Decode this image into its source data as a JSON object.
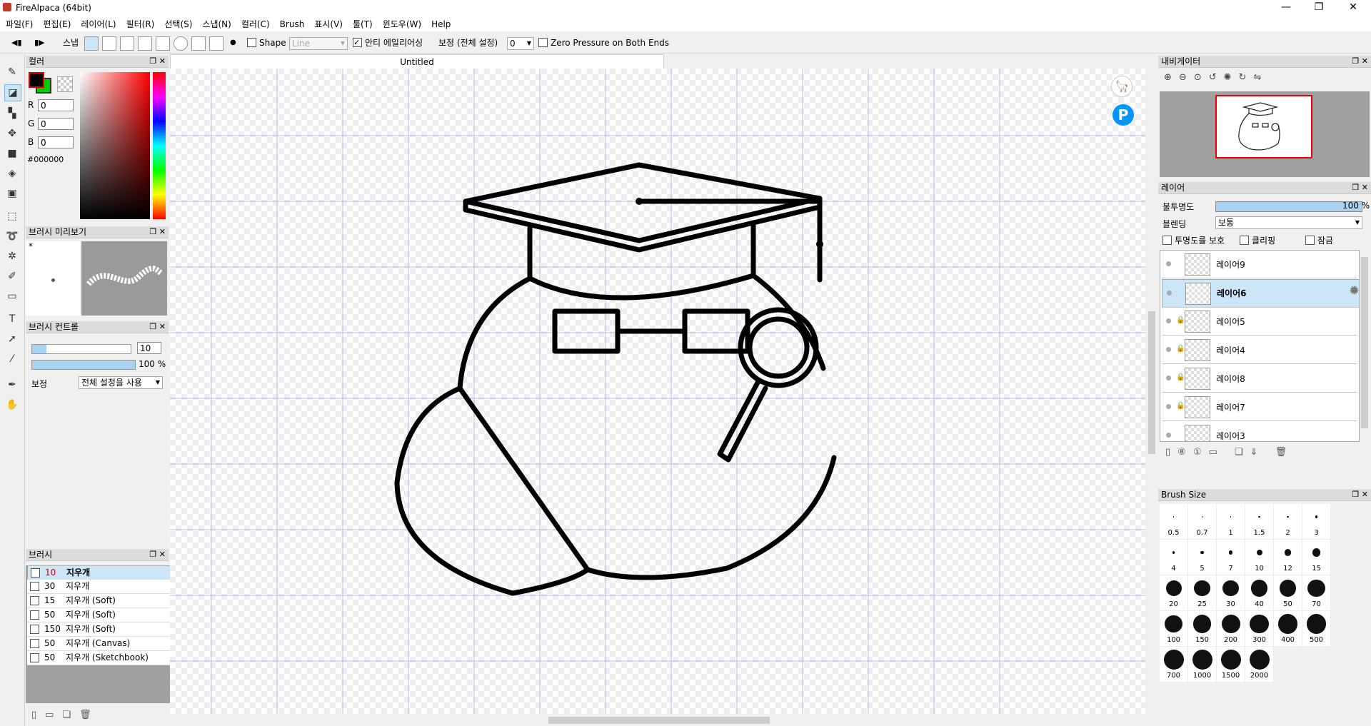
{
  "window": {
    "title": "FireAlpaca (64bit)",
    "minimize": "—",
    "maximize": "❐",
    "close": "✕"
  },
  "menu": [
    "파일(F)",
    "편집(E)",
    "레이어(L)",
    "필터(R)",
    "선택(S)",
    "스냅(N)",
    "컬러(C)",
    "Brush",
    "표시(V)",
    "툴(T)",
    "윈도우(W)",
    "Help"
  ],
  "toolbar": {
    "snap_label": "스냅",
    "shape_label": "Shape",
    "shape_value": "Line",
    "antialias_label": "안티 에일리어싱",
    "correction_label": "보정 (전체 설정)",
    "correction_value": "0",
    "zero_pressure_label": "Zero Pressure on Both Ends"
  },
  "color_panel": {
    "title": "컬러",
    "r_label": "R",
    "g_label": "G",
    "b_label": "B",
    "r": "0",
    "g": "0",
    "b": "0",
    "hex": "#000000",
    "primary_color": "#000000",
    "secondary_color": "#00cc00"
  },
  "brush_preview_panel": {
    "title": "브러시 미리보기",
    "marker": "*"
  },
  "brush_control_panel": {
    "title": "브러시 컨트롤",
    "size_value": "10",
    "opacity_value": "100 %",
    "correction_label": "보정",
    "correction_value": "전체 설정을 사용"
  },
  "brush_panel": {
    "title": "브러시",
    "items": [
      {
        "size": "10",
        "name": "지우개"
      },
      {
        "size": "30",
        "name": "지우개"
      },
      {
        "size": "15",
        "name": "지우개 (Soft)"
      },
      {
        "size": "50",
        "name": "지우개 (Soft)"
      },
      {
        "size": "150",
        "name": "지우개 (Soft)"
      },
      {
        "size": "50",
        "name": "지우개 (Canvas)"
      },
      {
        "size": "50",
        "name": "지우개 (Sketchbook)"
      }
    ]
  },
  "canvas": {
    "tab_title": "Untitled"
  },
  "navigator_panel": {
    "title": "내비게이터"
  },
  "layer_panel": {
    "title": "레이어",
    "opacity_label": "불투명도",
    "opacity_value": "100 %",
    "opacity_level": 1.0,
    "blend_label": "블렌딩",
    "blend_value": "보통",
    "protect_alpha_label": "투명도를 보호",
    "clipping_label": "클리핑",
    "lock_label": "잠금",
    "layers": [
      "레이어9",
      "레이어6",
      "레이어5",
      "레이어4",
      "레이어8",
      "레이어7",
      "레이어3"
    ]
  },
  "brush_size_panel": {
    "title": "Brush Size",
    "sizes": [
      "0.5",
      "0.7",
      "1",
      "1.5",
      "2",
      "3",
      "4",
      "5",
      "7",
      "10",
      "12",
      "15",
      "20",
      "25",
      "30",
      "40",
      "50",
      "70",
      "100",
      "150",
      "200",
      "300",
      "400",
      "500",
      "700",
      "1000",
      "1500",
      "2000"
    ]
  }
}
